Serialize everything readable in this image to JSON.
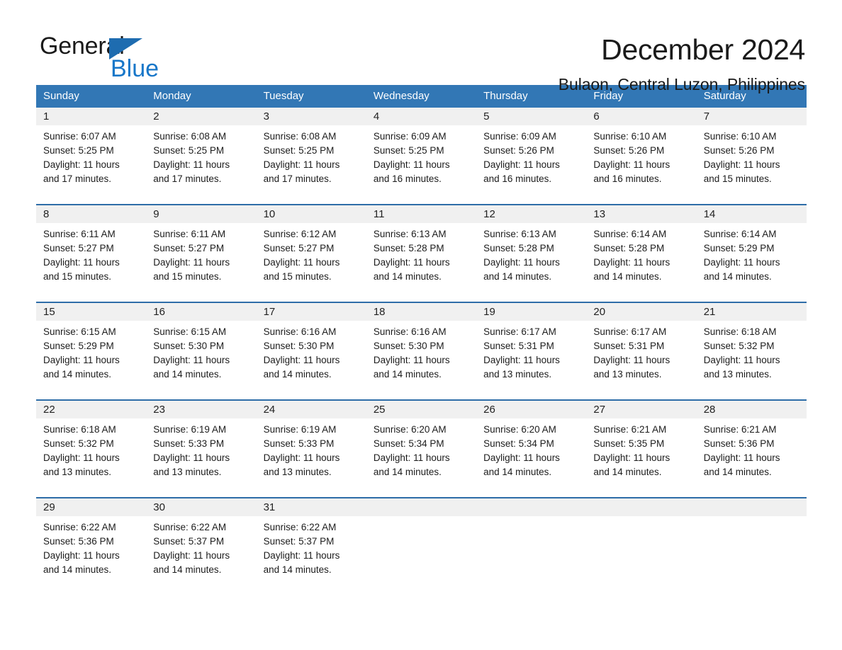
{
  "brand": {
    "name_part1": "General",
    "name_part2": "Blue",
    "triangle_color": "#1e6cb0",
    "blue_text_color": "#1877c9"
  },
  "header": {
    "title": "December 2024",
    "subtitle": "Bulaon, Central Luzon, Philippines"
  },
  "theme": {
    "header_bg": "#3277b5",
    "separator": "#2e6da8",
    "daynum_bg": "#f0f0f0",
    "text": "#1c1c1c"
  },
  "calendar": {
    "weekday_headers": [
      "Sunday",
      "Monday",
      "Tuesday",
      "Wednesday",
      "Thursday",
      "Friday",
      "Saturday"
    ],
    "weeks": [
      [
        {
          "day": "1",
          "sunrise": "Sunrise: 6:07 AM",
          "sunset": "Sunset: 5:25 PM",
          "daylight1": "Daylight: 11 hours",
          "daylight2": "and 17 minutes."
        },
        {
          "day": "2",
          "sunrise": "Sunrise: 6:08 AM",
          "sunset": "Sunset: 5:25 PM",
          "daylight1": "Daylight: 11 hours",
          "daylight2": "and 17 minutes."
        },
        {
          "day": "3",
          "sunrise": "Sunrise: 6:08 AM",
          "sunset": "Sunset: 5:25 PM",
          "daylight1": "Daylight: 11 hours",
          "daylight2": "and 17 minutes."
        },
        {
          "day": "4",
          "sunrise": "Sunrise: 6:09 AM",
          "sunset": "Sunset: 5:25 PM",
          "daylight1": "Daylight: 11 hours",
          "daylight2": "and 16 minutes."
        },
        {
          "day": "5",
          "sunrise": "Sunrise: 6:09 AM",
          "sunset": "Sunset: 5:26 PM",
          "daylight1": "Daylight: 11 hours",
          "daylight2": "and 16 minutes."
        },
        {
          "day": "6",
          "sunrise": "Sunrise: 6:10 AM",
          "sunset": "Sunset: 5:26 PM",
          "daylight1": "Daylight: 11 hours",
          "daylight2": "and 16 minutes."
        },
        {
          "day": "7",
          "sunrise": "Sunrise: 6:10 AM",
          "sunset": "Sunset: 5:26 PM",
          "daylight1": "Daylight: 11 hours",
          "daylight2": "and 15 minutes."
        }
      ],
      [
        {
          "day": "8",
          "sunrise": "Sunrise: 6:11 AM",
          "sunset": "Sunset: 5:27 PM",
          "daylight1": "Daylight: 11 hours",
          "daylight2": "and 15 minutes."
        },
        {
          "day": "9",
          "sunrise": "Sunrise: 6:11 AM",
          "sunset": "Sunset: 5:27 PM",
          "daylight1": "Daylight: 11 hours",
          "daylight2": "and 15 minutes."
        },
        {
          "day": "10",
          "sunrise": "Sunrise: 6:12 AM",
          "sunset": "Sunset: 5:27 PM",
          "daylight1": "Daylight: 11 hours",
          "daylight2": "and 15 minutes."
        },
        {
          "day": "11",
          "sunrise": "Sunrise: 6:13 AM",
          "sunset": "Sunset: 5:28 PM",
          "daylight1": "Daylight: 11 hours",
          "daylight2": "and 14 minutes."
        },
        {
          "day": "12",
          "sunrise": "Sunrise: 6:13 AM",
          "sunset": "Sunset: 5:28 PM",
          "daylight1": "Daylight: 11 hours",
          "daylight2": "and 14 minutes."
        },
        {
          "day": "13",
          "sunrise": "Sunrise: 6:14 AM",
          "sunset": "Sunset: 5:28 PM",
          "daylight1": "Daylight: 11 hours",
          "daylight2": "and 14 minutes."
        },
        {
          "day": "14",
          "sunrise": "Sunrise: 6:14 AM",
          "sunset": "Sunset: 5:29 PM",
          "daylight1": "Daylight: 11 hours",
          "daylight2": "and 14 minutes."
        }
      ],
      [
        {
          "day": "15",
          "sunrise": "Sunrise: 6:15 AM",
          "sunset": "Sunset: 5:29 PM",
          "daylight1": "Daylight: 11 hours",
          "daylight2": "and 14 minutes."
        },
        {
          "day": "16",
          "sunrise": "Sunrise: 6:15 AM",
          "sunset": "Sunset: 5:30 PM",
          "daylight1": "Daylight: 11 hours",
          "daylight2": "and 14 minutes."
        },
        {
          "day": "17",
          "sunrise": "Sunrise: 6:16 AM",
          "sunset": "Sunset: 5:30 PM",
          "daylight1": "Daylight: 11 hours",
          "daylight2": "and 14 minutes."
        },
        {
          "day": "18",
          "sunrise": "Sunrise: 6:16 AM",
          "sunset": "Sunset: 5:30 PM",
          "daylight1": "Daylight: 11 hours",
          "daylight2": "and 14 minutes."
        },
        {
          "day": "19",
          "sunrise": "Sunrise: 6:17 AM",
          "sunset": "Sunset: 5:31 PM",
          "daylight1": "Daylight: 11 hours",
          "daylight2": "and 13 minutes."
        },
        {
          "day": "20",
          "sunrise": "Sunrise: 6:17 AM",
          "sunset": "Sunset: 5:31 PM",
          "daylight1": "Daylight: 11 hours",
          "daylight2": "and 13 minutes."
        },
        {
          "day": "21",
          "sunrise": "Sunrise: 6:18 AM",
          "sunset": "Sunset: 5:32 PM",
          "daylight1": "Daylight: 11 hours",
          "daylight2": "and 13 minutes."
        }
      ],
      [
        {
          "day": "22",
          "sunrise": "Sunrise: 6:18 AM",
          "sunset": "Sunset: 5:32 PM",
          "daylight1": "Daylight: 11 hours",
          "daylight2": "and 13 minutes."
        },
        {
          "day": "23",
          "sunrise": "Sunrise: 6:19 AM",
          "sunset": "Sunset: 5:33 PM",
          "daylight1": "Daylight: 11 hours",
          "daylight2": "and 13 minutes."
        },
        {
          "day": "24",
          "sunrise": "Sunrise: 6:19 AM",
          "sunset": "Sunset: 5:33 PM",
          "daylight1": "Daylight: 11 hours",
          "daylight2": "and 13 minutes."
        },
        {
          "day": "25",
          "sunrise": "Sunrise: 6:20 AM",
          "sunset": "Sunset: 5:34 PM",
          "daylight1": "Daylight: 11 hours",
          "daylight2": "and 14 minutes."
        },
        {
          "day": "26",
          "sunrise": "Sunrise: 6:20 AM",
          "sunset": "Sunset: 5:34 PM",
          "daylight1": "Daylight: 11 hours",
          "daylight2": "and 14 minutes."
        },
        {
          "day": "27",
          "sunrise": "Sunrise: 6:21 AM",
          "sunset": "Sunset: 5:35 PM",
          "daylight1": "Daylight: 11 hours",
          "daylight2": "and 14 minutes."
        },
        {
          "day": "28",
          "sunrise": "Sunrise: 6:21 AM",
          "sunset": "Sunset: 5:36 PM",
          "daylight1": "Daylight: 11 hours",
          "daylight2": "and 14 minutes."
        }
      ],
      [
        {
          "day": "29",
          "sunrise": "Sunrise: 6:22 AM",
          "sunset": "Sunset: 5:36 PM",
          "daylight1": "Daylight: 11 hours",
          "daylight2": "and 14 minutes."
        },
        {
          "day": "30",
          "sunrise": "Sunrise: 6:22 AM",
          "sunset": "Sunset: 5:37 PM",
          "daylight1": "Daylight: 11 hours",
          "daylight2": "and 14 minutes."
        },
        {
          "day": "31",
          "sunrise": "Sunrise: 6:22 AM",
          "sunset": "Sunset: 5:37 PM",
          "daylight1": "Daylight: 11 hours",
          "daylight2": "and 14 minutes."
        },
        {
          "day": "",
          "sunrise": "",
          "sunset": "",
          "daylight1": "",
          "daylight2": ""
        },
        {
          "day": "",
          "sunrise": "",
          "sunset": "",
          "daylight1": "",
          "daylight2": ""
        },
        {
          "day": "",
          "sunrise": "",
          "sunset": "",
          "daylight1": "",
          "daylight2": ""
        },
        {
          "day": "",
          "sunrise": "",
          "sunset": "",
          "daylight1": "",
          "daylight2": ""
        }
      ]
    ]
  }
}
